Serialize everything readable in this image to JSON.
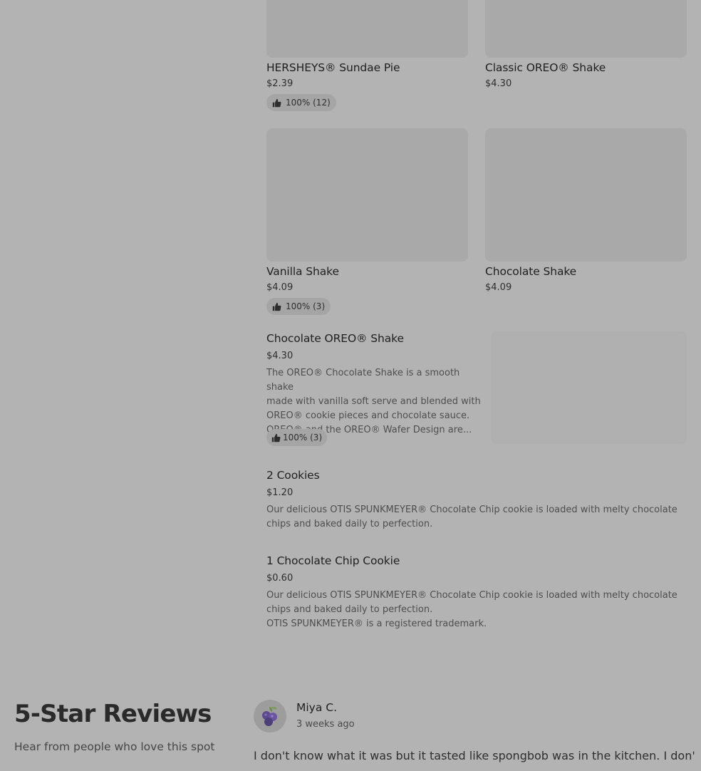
{
  "menu": {
    "items": [
      {
        "name": "HERSHEYS® Sundae Pie",
        "price": "$2.39",
        "rating": "100% (12)"
      },
      {
        "name": "Classic OREO® Shake",
        "price": "$4.30"
      },
      {
        "name": "Vanilla Shake",
        "price": "$4.09",
        "rating": "100% (3)"
      },
      {
        "name": "Chocolate Shake",
        "price": "$4.09"
      },
      {
        "name": "Chocolate OREO® Shake",
        "price": "$4.30",
        "description_lines": [
          "The OREO® Chocolate Shake is a smooth shake",
          "made with vanilla soft serve and blended with",
          "OREO® cookie pieces and chocolate sauce.",
          "OREO® and the OREO® Wafer Design are..."
        ],
        "rating": "100% (3)"
      },
      {
        "name": "2 Cookies",
        "price": "$1.20",
        "description_lines": [
          "Our delicious OTIS SPUNKMEYER® Chocolate Chip cookie is loaded with melty chocolate",
          "chips and baked daily to perfection."
        ]
      },
      {
        "name": "1 Chocolate Chip Cookie",
        "price": "$0.60",
        "description_lines": [
          "Our delicious OTIS SPUNKMEYER® Chocolate Chip cookie is loaded with melty chocolate",
          "chips and baked daily to perfection.",
          "OTIS SPUNKMEYER® is a registered trademark."
        ]
      }
    ]
  },
  "reviews": {
    "title": "5-Star Reviews",
    "subtitle": "Hear from people who love this spot",
    "items": [
      {
        "name": "Miya C.",
        "time": "3 weeks ago",
        "text": "I don't know what it was but it tasted like spongbob was in the kitchen. I don't go"
      }
    ]
  },
  "icons": {
    "rating": "thumbs-up-icon",
    "avatar": "blueberries-avatar-icon"
  },
  "colors": {
    "background": "#b3b3b3",
    "pill": "#a5a5a5",
    "image_placeholder": "#a9a9a9"
  }
}
